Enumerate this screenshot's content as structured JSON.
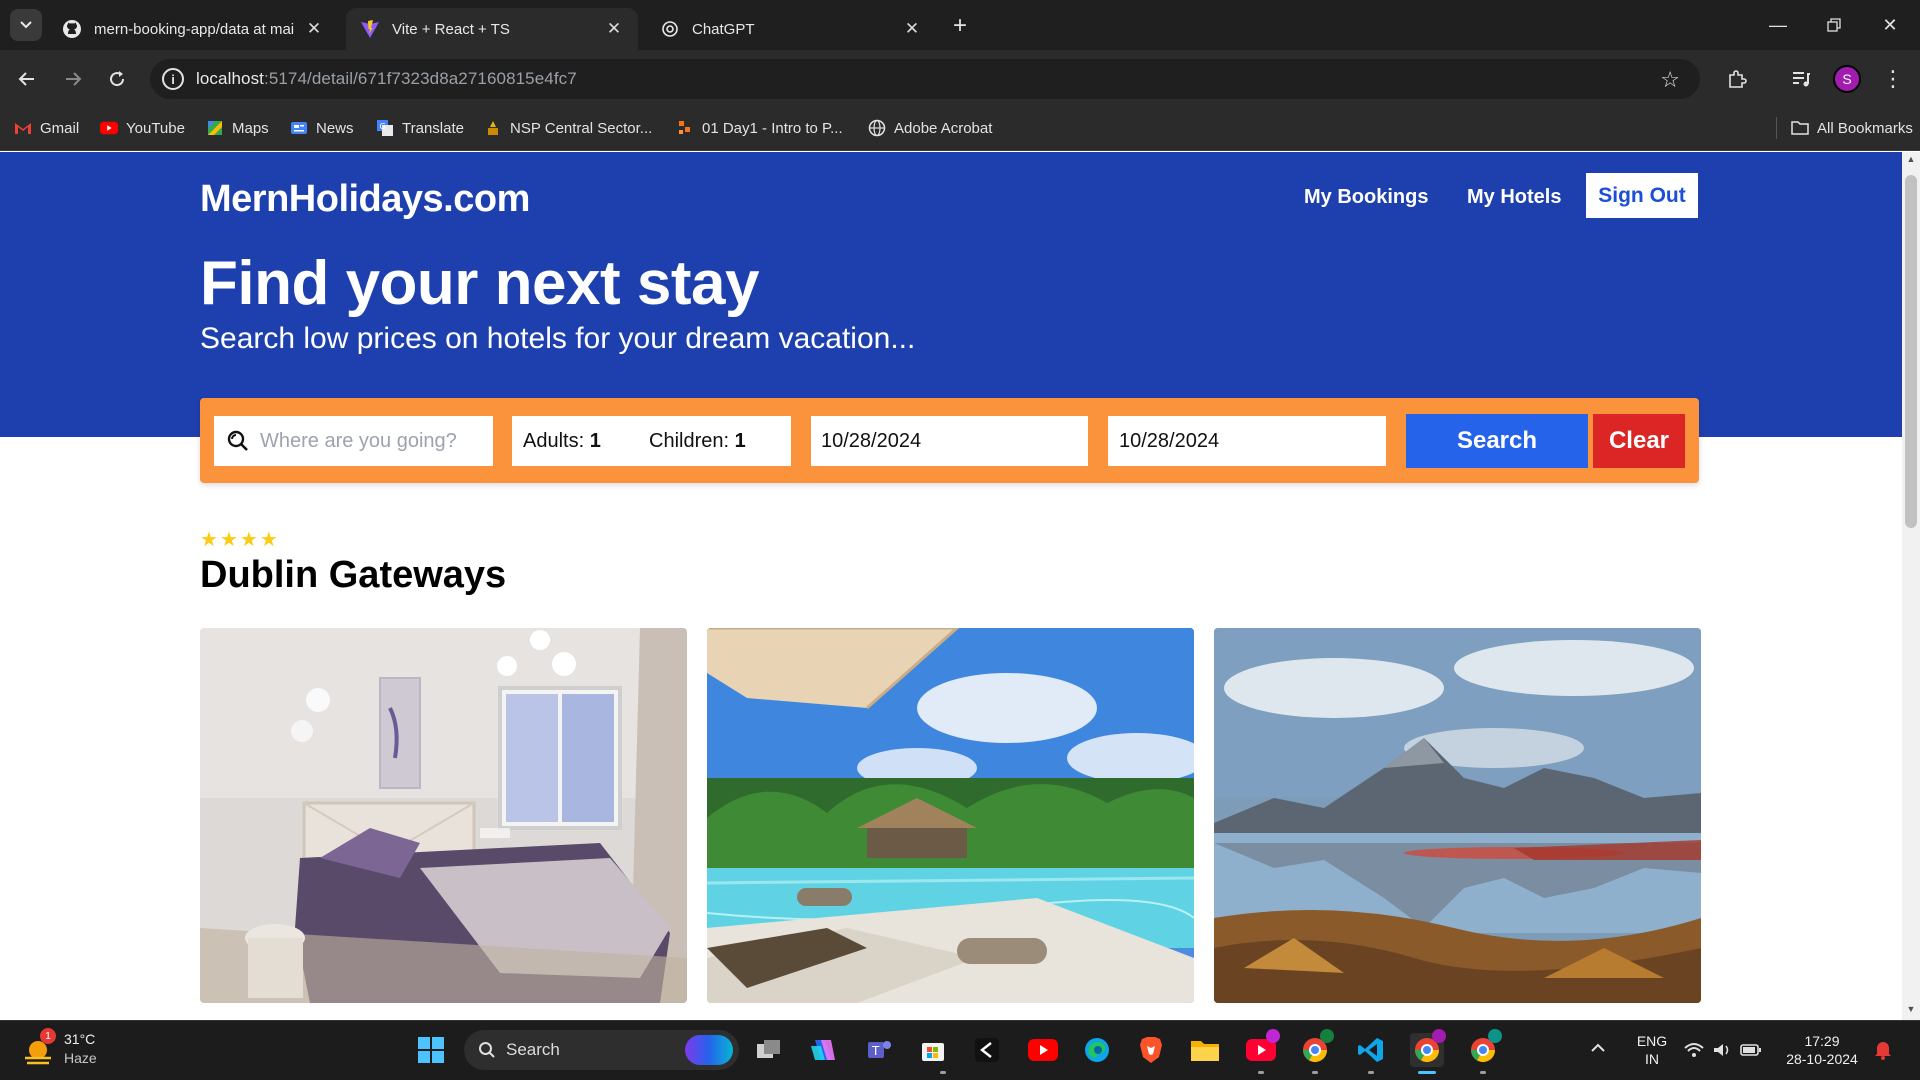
{
  "browser": {
    "tabs": [
      {
        "title": "mern-booking-app/data at mai",
        "active": false,
        "icon": "github-icon"
      },
      {
        "title": "Vite + React + TS",
        "active": true,
        "icon": "vite-icon"
      },
      {
        "title": "ChatGPT",
        "active": false,
        "icon": "openai-icon"
      }
    ],
    "url_host": "localhost",
    "url_path": ":5174/detail/671f7323d8a27160815e4fc7",
    "profile_initial": "S",
    "bookmarks": [
      {
        "label": "Gmail",
        "icon": "gmail-icon"
      },
      {
        "label": "YouTube",
        "icon": "youtube-icon"
      },
      {
        "label": "Maps",
        "icon": "maps-icon"
      },
      {
        "label": "News",
        "icon": "news-icon"
      },
      {
        "label": "Translate",
        "icon": "translate-icon"
      },
      {
        "label": "NSP Central Sector...",
        "icon": "emblem-icon"
      },
      {
        "label": "01 Day1 - Intro to P...",
        "icon": "bookmark-app-icon"
      },
      {
        "label": "Adobe Acrobat",
        "icon": "globe-icon"
      }
    ],
    "all_bookmarks_label": "All Bookmarks"
  },
  "header": {
    "logo": "MernHolidays.com",
    "nav": {
      "my_bookings": "My Bookings",
      "my_hotels": "My Hotels",
      "sign_out": "Sign Out"
    },
    "hero_title": "Find your next stay",
    "hero_subtitle": "Search low prices on hotels for your dream vacation..."
  },
  "search": {
    "destination_placeholder": "Where are you going?",
    "adults_label": "Adults:",
    "adults_value": "1",
    "children_label": "Children:",
    "children_value": "1",
    "check_in": "10/28/2024",
    "check_out": "10/28/2024",
    "search_button": "Search",
    "clear_button": "Clear"
  },
  "hotel": {
    "star_rating": 4,
    "name": "Dublin Gateways",
    "photos": [
      "bedroom-photo",
      "resort-pool-photo",
      "mountain-lake-photo"
    ]
  },
  "taskbar": {
    "weather_temp": "31°C",
    "weather_desc": "Haze",
    "weather_badge": "1",
    "search_label": "Search",
    "lang_top": "ENG",
    "lang_bottom": "IN",
    "time": "17:29",
    "date": "28-10-2024"
  },
  "colors": {
    "hero_blue": "#1e40af",
    "search_orange": "#fb923c",
    "search_button": "#2563eb",
    "clear_button": "#dc2626",
    "star": "#facc15"
  }
}
